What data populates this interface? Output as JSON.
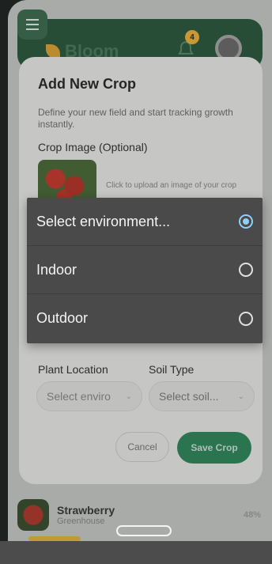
{
  "app": {
    "logo_text": "Bloom",
    "notification_count": "4"
  },
  "modal": {
    "title": "Add New Crop",
    "description": "Define your new field and start tracking growth instantly.",
    "crop_image_label": "Crop Image (Optional)",
    "upload_hint": "Click to upload an image of your crop",
    "plant_location_label": "Plant Location",
    "plant_location_value": "Select enviro",
    "soil_type_label": "Soil Type",
    "soil_type_value": "Select soil...",
    "cancel_label": "Cancel",
    "save_label": "Save Crop"
  },
  "dropdown": {
    "options": [
      {
        "label": "Select environment...",
        "selected": true
      },
      {
        "label": "Indoor",
        "selected": false
      },
      {
        "label": "Outdoor",
        "selected": false
      }
    ]
  },
  "crop_list": {
    "items": [
      {
        "name": "Strawberry",
        "location": "Greenhouse",
        "progress": "48%"
      }
    ]
  },
  "colors": {
    "brand_green": "#2f8a5d",
    "radio_accent": "#8fd0f7",
    "badge": "#f0b63a"
  },
  "icons": {
    "menu": "menu-icon",
    "bell": "bell-icon",
    "avatar": "avatar",
    "chevron": "chevron-down-icon",
    "radio": "radio-icon"
  }
}
